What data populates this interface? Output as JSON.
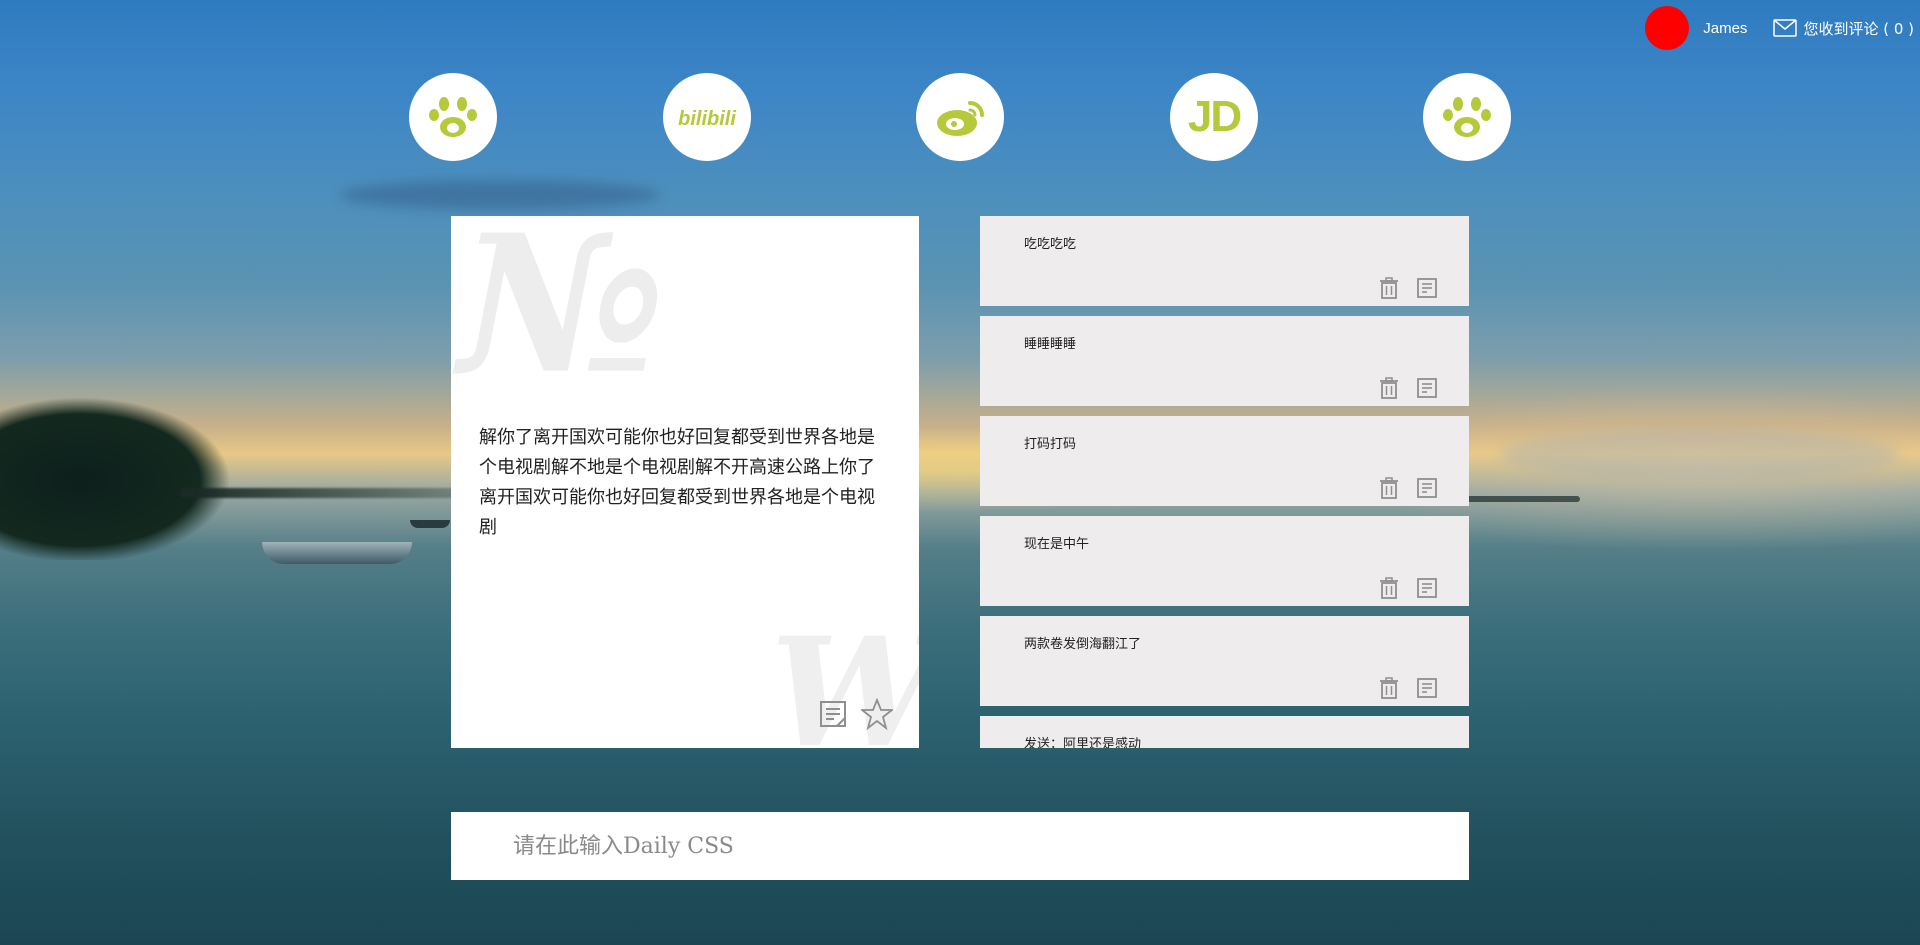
{
  "colors": {
    "icon_accent": "#b5c93b",
    "avatar": "#ff0000",
    "card_bg": "#ffffff",
    "message_bg": "#eeecec",
    "action_icon": "#8f8f8f"
  },
  "header": {
    "username": "James",
    "comments_label": "您收到评论 ( 0 )",
    "mail_icon": "mail-icon"
  },
  "sites": [
    {
      "name": "baidu",
      "icon": "paw-icon"
    },
    {
      "name": "bilibili",
      "icon": "bilibili-icon",
      "label": "bilibili"
    },
    {
      "name": "weibo",
      "icon": "weibo-icon"
    },
    {
      "name": "jd",
      "icon": "jd-icon",
      "label": "JD"
    },
    {
      "name": "baidu",
      "icon": "paw-icon"
    }
  ],
  "feature_card": {
    "text": "解你了离开国欢可能你也好回复都受到世界各地是个电视剧解不地是个电视剧解不开高速公路上你了离开国欢可能你也好回复都受到世界各地是个电视剧",
    "actions": [
      "note-icon",
      "star-icon"
    ]
  },
  "messages": [
    {
      "text": "吃吃吃吃"
    },
    {
      "text": "睡睡睡睡"
    },
    {
      "text": "打码打码"
    },
    {
      "text": "现在是中午"
    },
    {
      "text": "两款卷发倒海翻江了"
    },
    {
      "text": "发送：阿里还是感动"
    }
  ],
  "input": {
    "placeholder": "请在此输入Daily CSS",
    "value": ""
  }
}
